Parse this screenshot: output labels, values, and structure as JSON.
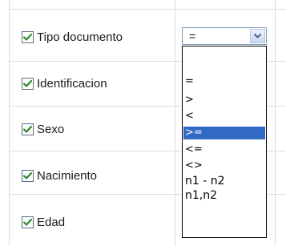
{
  "filters": [
    {
      "label": "Tipo documento",
      "checked": true
    },
    {
      "label": "Identificacion",
      "checked": true
    },
    {
      "label": "Sexo",
      "checked": true
    },
    {
      "label": "Nacimiento",
      "checked": true
    },
    {
      "label": "Edad",
      "checked": true
    }
  ],
  "operator_select": {
    "value": "=",
    "options": [
      "",
      "=",
      ">",
      "<",
      ">=",
      "<=",
      "<>",
      "n1 - n2",
      "n1,n2"
    ],
    "highlighted": ">="
  },
  "colors": {
    "check": "#2a8a2a",
    "highlight": "#316ac5",
    "grid": "#d6dde6"
  },
  "icons": {
    "checkbox": "checkmark-icon",
    "dropdown": "chevron-down-icon"
  }
}
